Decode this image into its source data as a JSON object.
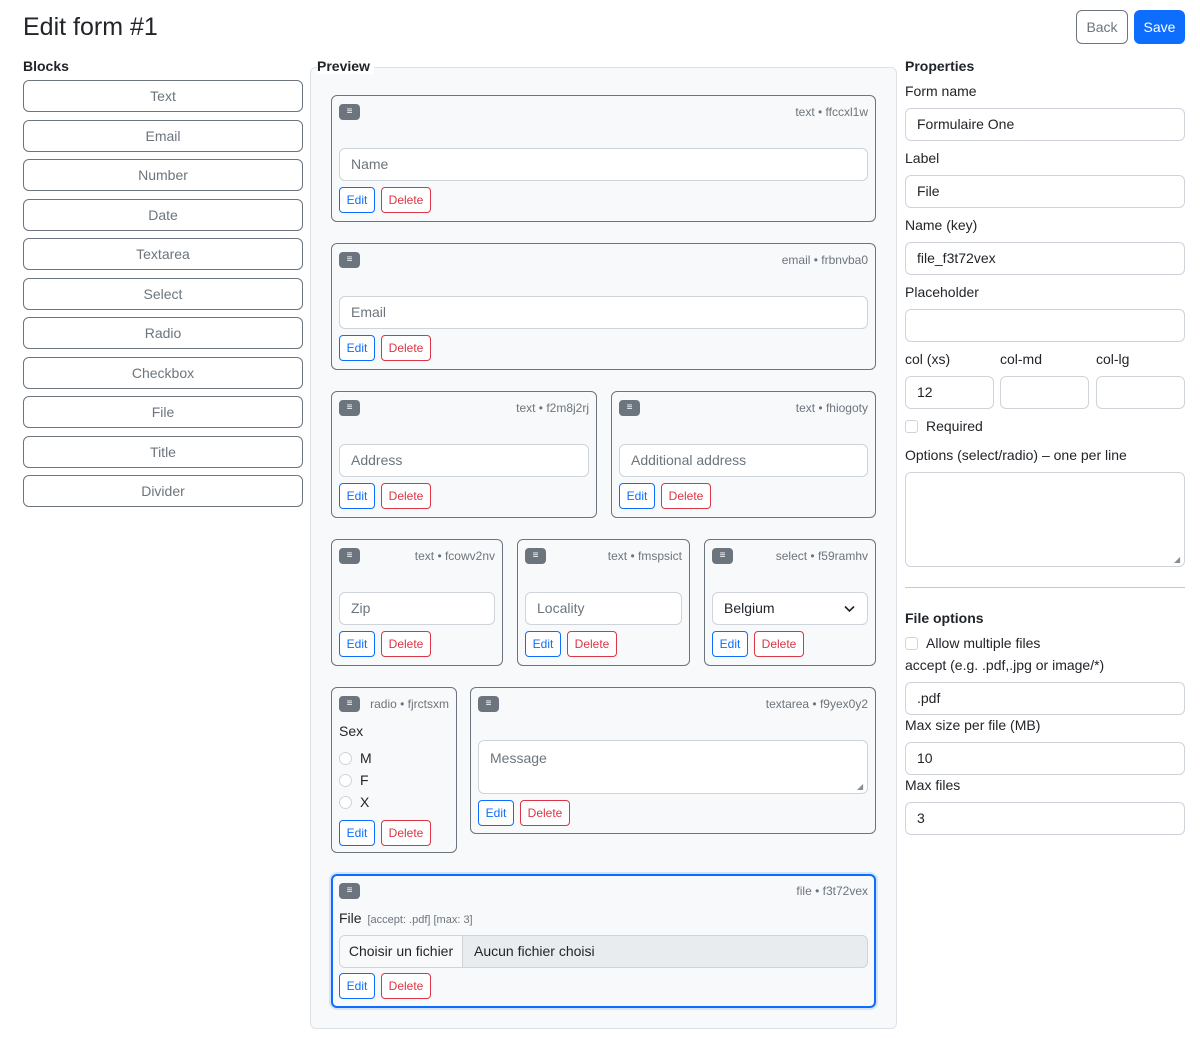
{
  "header": {
    "title": "Edit form #1",
    "back_label": "Back",
    "save_label": "Save"
  },
  "blocks": {
    "heading": "Blocks",
    "items": [
      "Text",
      "Email",
      "Number",
      "Date",
      "Textarea",
      "Select",
      "Radio",
      "Checkbox",
      "File",
      "Title",
      "Divider"
    ]
  },
  "preview": {
    "heading": "Preview",
    "handle_glyph": "≡",
    "edit_label": "Edit",
    "delete_label": "Delete",
    "fields": [
      {
        "meta": "text • ffccxl1w",
        "placeholder": "Name"
      },
      {
        "meta": "email • frbnvba0",
        "placeholder": "Email"
      },
      {
        "meta": "text • f2m8j2rj",
        "placeholder": "Address"
      },
      {
        "meta": "text • fhiogoty",
        "placeholder": "Additional address"
      },
      {
        "meta": "text • fcowv2nv",
        "placeholder": "Zip"
      },
      {
        "meta": "text • fmspsict",
        "placeholder": "Locality"
      },
      {
        "meta": "select • f59ramhv",
        "value": "Belgium"
      },
      {
        "meta": "radio • fjrctsxm",
        "label": "Sex",
        "options": [
          "M",
          "F",
          "X"
        ]
      },
      {
        "meta": "textarea • f9yex0y2",
        "placeholder": "Message"
      },
      {
        "meta": "file • f3t72vex",
        "label": "File",
        "hint": "[accept: .pdf] [max: 3]",
        "button": "Choisir un fichier",
        "status": "Aucun fichier choisi"
      }
    ]
  },
  "properties": {
    "heading": "Properties",
    "form_name_label": "Form name",
    "form_name": "Formulaire One",
    "label_label": "Label",
    "label": "File",
    "key_label": "Name (key)",
    "key": "file_f3t72vex",
    "placeholder_label": "Placeholder",
    "placeholder": "",
    "col_xs_label": "col (xs)",
    "col_md_label": "col-md",
    "col_lg_label": "col-lg",
    "col_xs": "12",
    "col_md": "",
    "col_lg": "",
    "required_label": "Required",
    "required": false,
    "options_label": "Options (select/radio) – one per line",
    "options": ""
  },
  "file_options": {
    "heading": "File options",
    "multiple_label": "Allow multiple files",
    "multiple": false,
    "accept_label": "accept (e.g. .pdf,.jpg or image/*)",
    "accept": ".pdf",
    "max_size_label": "Max size per file (MB)",
    "max_size": "10",
    "max_files_label": "Max files",
    "max_files": "3"
  },
  "colors": {
    "primary": "#0d6efd",
    "danger": "#dc3545",
    "secondary": "#6c757d",
    "panel": "#f8f9fa"
  }
}
